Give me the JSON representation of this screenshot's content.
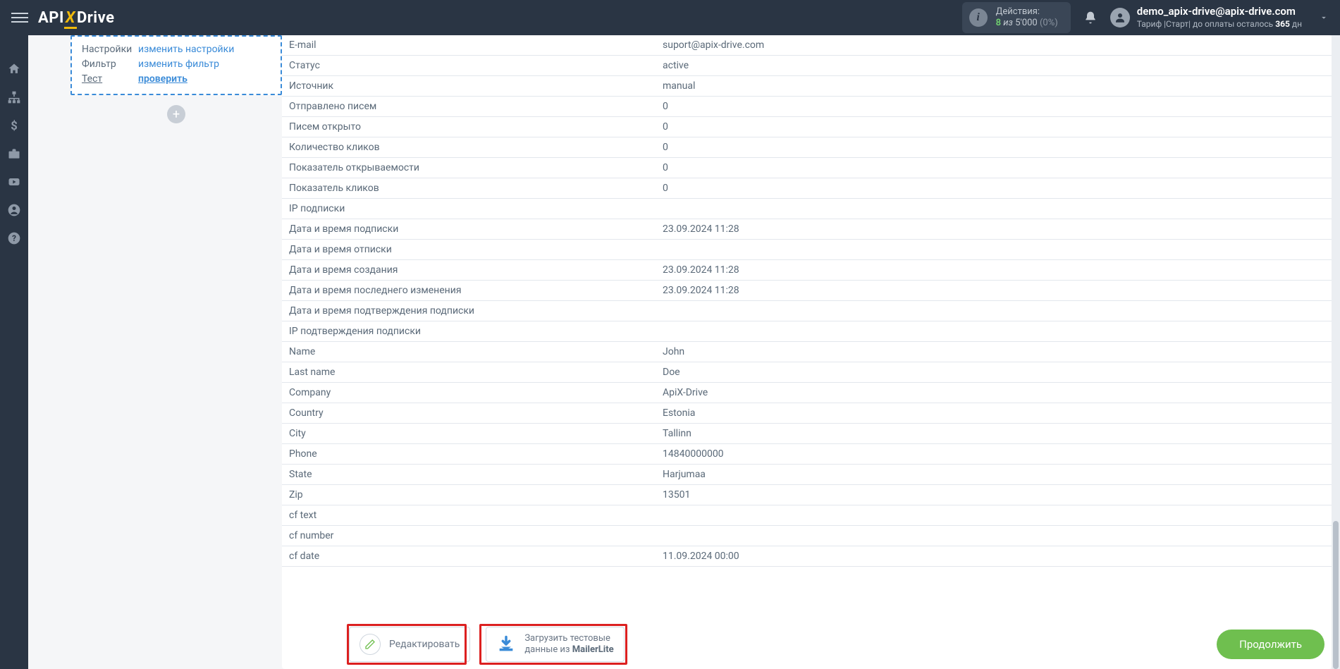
{
  "header": {
    "logo_api": "API",
    "logo_x": "X",
    "logo_drive": "Drive",
    "actions_label": "Действия:",
    "actions_count": "8",
    "actions_of": "из",
    "actions_total": "5'000",
    "actions_pct": "(0%)",
    "user_email": "demo_apix-drive@apix-drive.com",
    "user_plan_prefix": "Тариф |Старт| до оплаты осталось",
    "user_plan_days": "365",
    "user_plan_suffix": "дн"
  },
  "card": {
    "rows": [
      {
        "label": "Настройки",
        "link": "изменить настройки",
        "underline": false
      },
      {
        "label": "Фильтр",
        "link": "изменить фильтр",
        "underline": false
      },
      {
        "label": "Тест",
        "link": "проверить",
        "underline": true
      }
    ]
  },
  "add_glyph": "+",
  "table": {
    "rows": [
      {
        "k": "E-mail",
        "v": "suport@apix-drive.com"
      },
      {
        "k": "Статус",
        "v": "active"
      },
      {
        "k": "Источник",
        "v": "manual"
      },
      {
        "k": "Отправлено писем",
        "v": "0"
      },
      {
        "k": "Писем открыто",
        "v": "0"
      },
      {
        "k": "Количество кликов",
        "v": "0"
      },
      {
        "k": "Показатель открываемости",
        "v": "0"
      },
      {
        "k": "Показатель кликов",
        "v": "0"
      },
      {
        "k": "IP подписки",
        "v": ""
      },
      {
        "k": "Дата и время подписки",
        "v": "23.09.2024 11:28"
      },
      {
        "k": "Дата и время отписки",
        "v": ""
      },
      {
        "k": "Дата и время создания",
        "v": "23.09.2024 11:28"
      },
      {
        "k": "Дата и время последнего изменения",
        "v": "23.09.2024 11:28"
      },
      {
        "k": "Дата и время подтверждения подписки",
        "v": ""
      },
      {
        "k": "IP подтверждения подписки",
        "v": ""
      },
      {
        "k": "Name",
        "v": "John"
      },
      {
        "k": "Last name",
        "v": "Doe"
      },
      {
        "k": "Company",
        "v": "ApiX-Drive"
      },
      {
        "k": "Country",
        "v": "Estonia"
      },
      {
        "k": "City",
        "v": "Tallinn"
      },
      {
        "k": "Phone",
        "v": "14840000000"
      },
      {
        "k": "State",
        "v": "Harjumaa"
      },
      {
        "k": "Zip",
        "v": "13501"
      },
      {
        "k": "cf text",
        "v": ""
      },
      {
        "k": "cf number",
        "v": ""
      },
      {
        "k": "cf date",
        "v": "11.09.2024 00:00"
      }
    ]
  },
  "buttons": {
    "edit": "Редактировать",
    "load_l1": "Загрузить тестовые",
    "load_l2_pre": "данные из ",
    "load_l2_b": "MailerLite",
    "continue": "Продолжить"
  }
}
